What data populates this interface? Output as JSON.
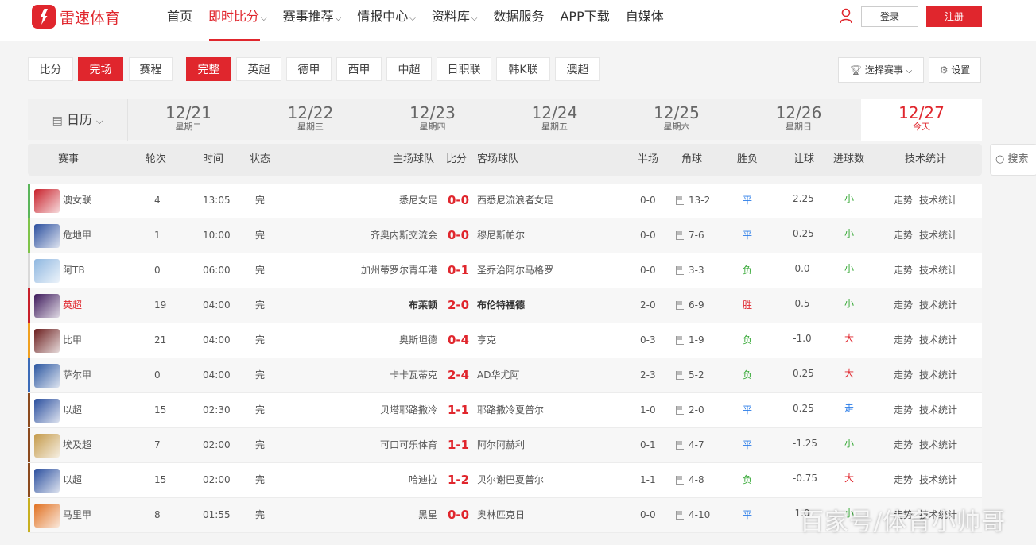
{
  "header": {
    "logo_text": "雷速体育",
    "nav": [
      {
        "label": "首页",
        "dropdown": false
      },
      {
        "label": "即时比分",
        "dropdown": true,
        "active": true
      },
      {
        "label": "赛事推荐",
        "dropdown": true
      },
      {
        "label": "情报中心",
        "dropdown": true
      },
      {
        "label": "资料库",
        "dropdown": true
      },
      {
        "label": "数据服务",
        "dropdown": false
      },
      {
        "label": "APP下载",
        "dropdown": false
      },
      {
        "label": "自媒体",
        "dropdown": false
      }
    ],
    "login": "登录",
    "register": "注册"
  },
  "filters": {
    "mode": [
      "比分",
      "完场",
      "赛程"
    ],
    "mode_active": "完场",
    "leagues": [
      "完整",
      "英超",
      "德甲",
      "西甲",
      "中超",
      "日职联",
      "韩K联",
      "澳超"
    ],
    "league_active": "完整",
    "select_event": "选择赛事",
    "settings": "设置"
  },
  "datebar": {
    "calendar": "日历",
    "dates": [
      {
        "date": "12/21",
        "weekday": "星期二"
      },
      {
        "date": "12/22",
        "weekday": "星期三"
      },
      {
        "date": "12/23",
        "weekday": "星期四"
      },
      {
        "date": "12/24",
        "weekday": "星期五"
      },
      {
        "date": "12/25",
        "weekday": "星期六"
      },
      {
        "date": "12/26",
        "weekday": "星期日"
      },
      {
        "date": "12/27",
        "weekday": "今天",
        "today": true
      }
    ]
  },
  "table": {
    "headers": {
      "league": "赛事",
      "round": "轮次",
      "time": "时间",
      "status": "状态",
      "home": "主场球队",
      "score": "比分",
      "away": "客场球队",
      "half": "半场",
      "corner": "角球",
      "result": "胜负",
      "handicap": "让球",
      "goals": "进球数",
      "stats": "技术统计"
    },
    "search": "搜索",
    "trend": "走势",
    "tech": "技术统计",
    "rows": [
      {
        "league": "澳女联",
        "round": "4",
        "time": "13:05",
        "status": "完",
        "home": "悉尼女足",
        "score": "0-0",
        "away": "西悉尼流浪者女足",
        "half": "0-0",
        "corner": "13-2",
        "result": "平",
        "handicap": "2.25",
        "ou": "小",
        "bar": "#5ab55a",
        "logo": "#c8202a",
        "bold": false
      },
      {
        "league": "危地甲",
        "round": "1",
        "time": "10:00",
        "status": "完",
        "home": "齐奥内斯交流会",
        "score": "0-0",
        "away": "穆尼斯帕尔",
        "half": "0-0",
        "corner": "7-6",
        "result": "平",
        "handicap": "0.25",
        "ou": "小",
        "bar": "#7fc44a",
        "logo": "#2b4f9e",
        "bold": false
      },
      {
        "league": "阿TB",
        "round": "0",
        "time": "06:00",
        "status": "完",
        "home": "加州蒂罗尔青年港",
        "score": "0-1",
        "away": "圣乔治阿尔马格罗",
        "half": "0-0",
        "corner": "3-3",
        "result": "负",
        "handicap": "0.0",
        "ou": "小",
        "bar": "#d9d9d9",
        "logo": "#8fb7e0",
        "bold": false
      },
      {
        "league": "英超",
        "round": "19",
        "time": "04:00",
        "status": "完",
        "home": "布莱顿",
        "score": "2-0",
        "away": "布伦特福德",
        "half": "2-0",
        "corner": "6-9",
        "result": "胜",
        "handicap": "0.5",
        "ou": "小",
        "bar": "#c8202a",
        "logo": "#3d195b",
        "bold": true
      },
      {
        "league": "比甲",
        "round": "21",
        "time": "04:00",
        "status": "完",
        "home": "奥斯坦德",
        "score": "0-4",
        "away": "亨克",
        "half": "0-3",
        "corner": "1-9",
        "result": "负",
        "handicap": "-1.0",
        "ou": "大",
        "bar": "#f0a020",
        "logo": "#6b1e1e",
        "bold": false
      },
      {
        "league": "萨尔甲",
        "round": "0",
        "time": "04:00",
        "status": "完",
        "home": "卡卡瓦蒂克",
        "score": "2-4",
        "away": "AD华尤阿",
        "half": "2-3",
        "corner": "5-2",
        "result": "负",
        "handicap": "0.25",
        "ou": "大",
        "bar": "#3b6bb8",
        "logo": "#2b56a0",
        "bold": false
      },
      {
        "league": "以超",
        "round": "15",
        "time": "02:30",
        "status": "完",
        "home": "贝塔耶路撒冷",
        "score": "1-1",
        "away": "耶路撒冷夏普尔",
        "half": "1-0",
        "corner": "2-0",
        "result": "平",
        "handicap": "0.25",
        "ou": "走",
        "bar": "#8b4a1e",
        "logo": "#2b4f9e",
        "bold": false
      },
      {
        "league": "埃及超",
        "round": "7",
        "time": "02:00",
        "status": "完",
        "home": "可口可乐体育",
        "score": "1-1",
        "away": "阿尔阿赫利",
        "half": "0-1",
        "corner": "4-7",
        "result": "平",
        "handicap": "-1.25",
        "ou": "小",
        "bar": "#8b4a1e",
        "logo": "#c49a4a",
        "bold": false
      },
      {
        "league": "以超",
        "round": "15",
        "time": "02:00",
        "status": "完",
        "home": "哈迪拉",
        "score": "1-2",
        "away": "贝尔谢巴夏普尔",
        "half": "1-1",
        "corner": "4-8",
        "result": "负",
        "handicap": "-0.75",
        "ou": "大",
        "bar": "#8b4a1e",
        "logo": "#2b4f9e",
        "bold": false
      },
      {
        "league": "马里甲",
        "round": "8",
        "time": "01:55",
        "status": "完",
        "home": "黑星",
        "score": "0-0",
        "away": "奥林匹克日",
        "half": "0-0",
        "corner": "4-10",
        "result": "平",
        "handicap": "1.0",
        "ou": "小",
        "bar": "#c8b020",
        "logo": "#e07020",
        "bold": false
      }
    ]
  },
  "watermark": "百家号/体育小帅哥"
}
